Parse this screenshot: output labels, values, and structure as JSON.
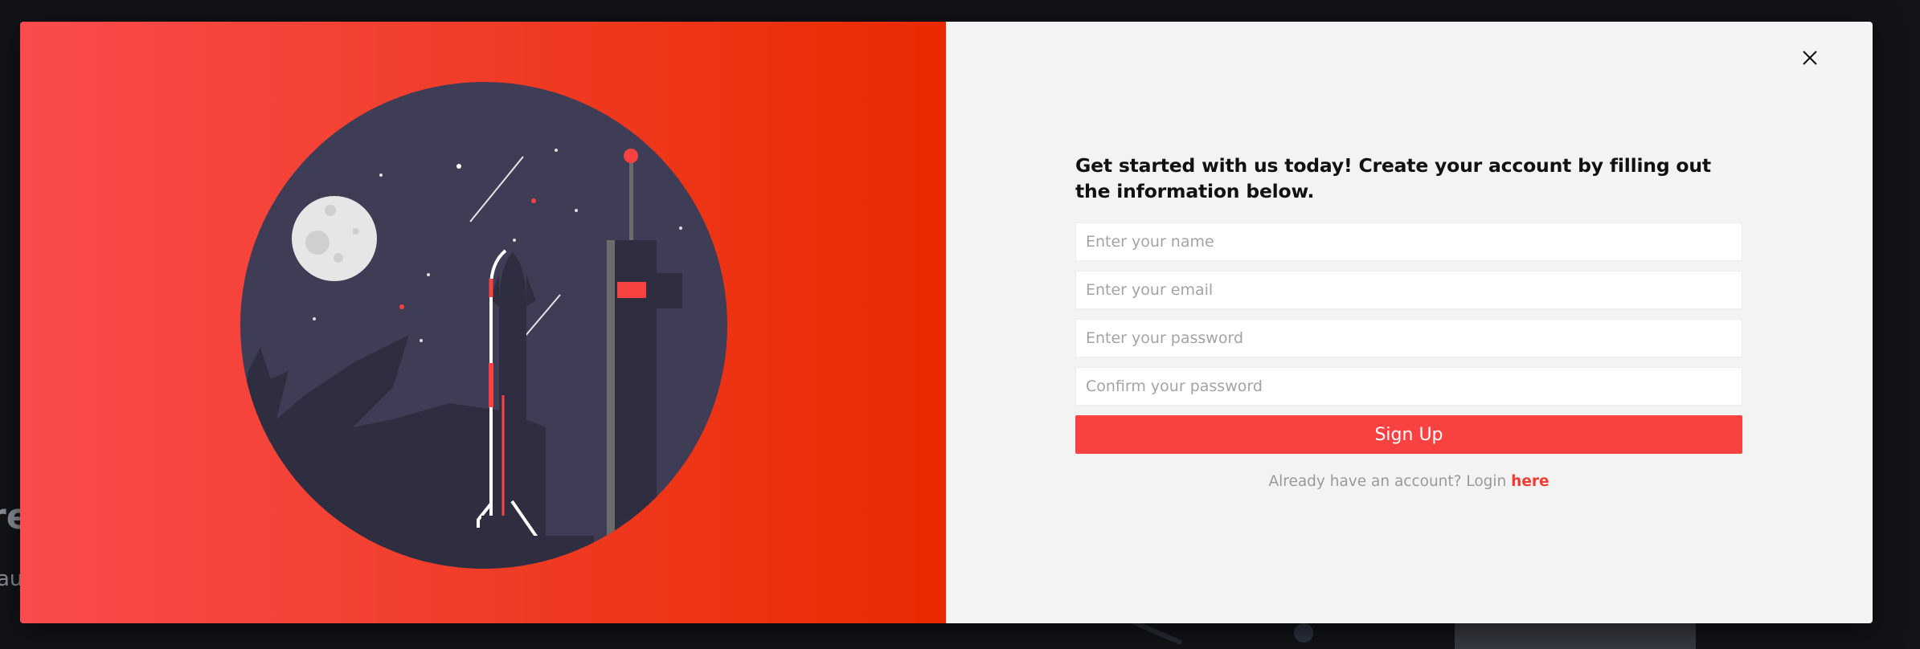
{
  "background": {
    "heading_fragment": "re",
    "sub_fragment": "au"
  },
  "modal": {
    "close_icon": "close-icon",
    "heading": "Get started with us today! Create your account by filling out the information below.",
    "fields": {
      "name_placeholder": "Enter your name",
      "email_placeholder": "Enter your email",
      "password_placeholder": "Enter your password",
      "confirm_placeholder": "Confirm your password"
    },
    "signup_label": "Sign Up",
    "login_prompt": "Already have an account? Login",
    "login_link": "here"
  },
  "colors": {
    "accent": "#f84241",
    "gradient_start": "#fb4b4e",
    "gradient_end": "#ea2a00",
    "panel_bg": "#f3f3f3",
    "page_bg": "#121419"
  }
}
